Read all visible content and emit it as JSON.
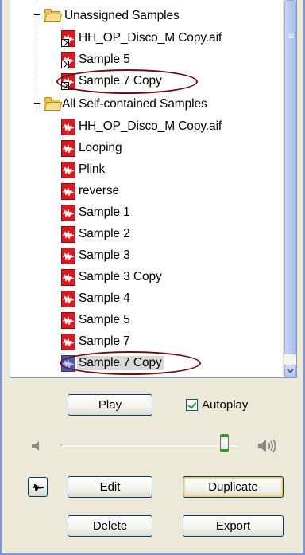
{
  "tree": {
    "groups": [
      {
        "label": "Unassigned Samples",
        "items": [
          {
            "label": "HH_OP_Disco_M Copy.aif",
            "icon": "sample-alias-icon"
          },
          {
            "label": "Sample 5",
            "icon": "sample-alias-icon"
          },
          {
            "label": "Sample 7 Copy",
            "icon": "sample-alias-icon",
            "circled": true
          }
        ]
      },
      {
        "label": "All Self-contained Samples",
        "items": [
          {
            "label": "HH_OP_Disco_M Copy.aif",
            "icon": "sample-icon"
          },
          {
            "label": "Looping",
            "icon": "sample-icon"
          },
          {
            "label": "Plink",
            "icon": "sample-icon"
          },
          {
            "label": "reverse",
            "icon": "sample-icon"
          },
          {
            "label": "Sample 1",
            "icon": "sample-icon"
          },
          {
            "label": "Sample 2",
            "icon": "sample-icon"
          },
          {
            "label": "Sample 3",
            "icon": "sample-icon"
          },
          {
            "label": "Sample 3 Copy",
            "icon": "sample-icon"
          },
          {
            "label": "Sample 4",
            "icon": "sample-icon"
          },
          {
            "label": "Sample 5",
            "icon": "sample-icon"
          },
          {
            "label": "Sample 7",
            "icon": "sample-icon"
          },
          {
            "label": "Sample 7 Copy",
            "icon": "sample-icon",
            "selected": true,
            "circled": true
          }
        ]
      }
    ]
  },
  "controls": {
    "play_label": "Play",
    "autoplay_label": "Autoplay",
    "autoplay_checked": true,
    "volume_level": 0.92,
    "edit_label": "Edit",
    "duplicate_label": "Duplicate",
    "delete_label": "Delete",
    "export_label": "Export"
  },
  "colors": {
    "circle_annotation": "#6e0d14",
    "sample_icon": "#d71920",
    "selection": "#d9d9d9"
  }
}
